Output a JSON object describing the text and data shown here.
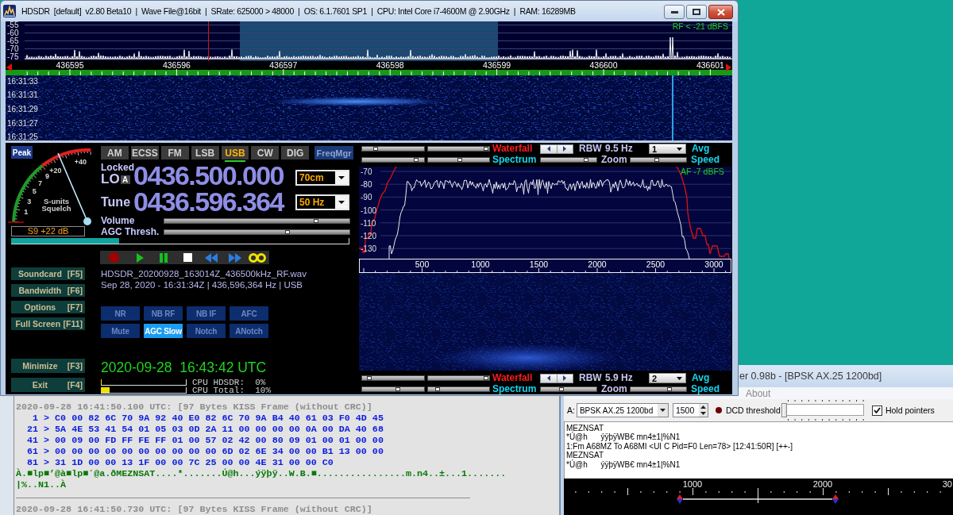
{
  "hdsdr": {
    "title": "HDSDR  [default]  v2.80 Beta10  |  Wave File@16bit  |  SRate: 625000 > 48000  |  OS: 6.1.7601 SP1  |  CPU: Intel Core i7-4600M @ 2.90GHz  |  RAM: 16289MB",
    "rf_spectrum": {
      "y_labels": [
        "-55",
        "-60",
        "-65",
        "-70",
        "-75"
      ],
      "reading": "RF < -21 dBFS",
      "freq_labels": [
        "436595",
        "436596",
        "436597",
        "436598",
        "436599",
        "436600",
        "436601"
      ]
    },
    "waterfall": {
      "times": [
        "16:31:33",
        "16:31:31",
        "16:31:29",
        "16:31:27",
        "16:31:25"
      ]
    },
    "s_meter": {
      "peak": "Peak",
      "scale": [
        "+40",
        "+20",
        "9",
        "7",
        "5",
        "3",
        "1"
      ],
      "captions": [
        "S-units",
        "Squelch"
      ],
      "reading": "S9 +22 dB",
      "level": 0.32
    },
    "modes": [
      {
        "label": "AM",
        "selected": false
      },
      {
        "label": "ECSS",
        "selected": false
      },
      {
        "label": "FM",
        "selected": false
      },
      {
        "label": "LSB",
        "selected": false
      },
      {
        "label": "USB",
        "selected": true
      },
      {
        "label": "CW",
        "selected": false
      },
      {
        "label": "DIG",
        "selected": false
      }
    ],
    "freq_manager": "FreqMgr",
    "lo": {
      "status": "Locked",
      "label": "LO",
      "vfo": "A",
      "frequency": "0436.500.000",
      "band": "70cm"
    },
    "tune": {
      "label": "Tune",
      "frequency": "0436.596.364",
      "step": "50 Hz"
    },
    "sliders": [
      {
        "label": "Volume",
        "level": 0.83
      },
      {
        "label": "AGC Thresh.",
        "level": 0.67
      }
    ],
    "recording": {
      "file": "HDSDR_20200928_163014Z_436500kHz_RF.wav",
      "info": "Sep 28, 2020 - 16:31:34Z | 436,596,364 Hz | USB"
    },
    "functions": [
      {
        "label": "NR",
        "on": false
      },
      {
        "label": "NB RF",
        "on": false
      },
      {
        "label": "NB IF",
        "on": false
      },
      {
        "label": "AFC",
        "on": false
      },
      {
        "label": "Mute",
        "on": false
      },
      {
        "label": "AGC Slow",
        "on": true
      },
      {
        "label": "Notch",
        "on": false
      },
      {
        "label": "ANotch",
        "on": false
      }
    ],
    "side_buttons": [
      {
        "label": "Soundcard",
        "key": "[F5]"
      },
      {
        "label": "Bandwidth",
        "key": "[F6]"
      },
      {
        "label": "Options",
        "key": "[F7]"
      },
      {
        "label": "Full Screen",
        "key": "[F11]"
      }
    ],
    "app_buttons": [
      {
        "label": "Minimize",
        "key": "[F3]"
      },
      {
        "label": "Exit",
        "key": "[F4]"
      }
    ],
    "clock": "2020-09-28  16:43:42 UTC",
    "cpu": [
      {
        "label": "CPU HDSDR:  0%",
        "level": 0
      },
      {
        "label": "CPU Total:  10%",
        "level": 0.1
      }
    ],
    "af_controls": [
      {
        "waterfall_label": "Waterfall",
        "rbw_label": "RBW",
        "rbw": "9.5 Hz",
        "avg": "1",
        "avg_label": "Avg",
        "spectrum_label": "Spectrum",
        "zoom_label": "Zoom",
        "speed_label": "Speed",
        "sliders": [
          {
            "level": 0.2
          },
          {
            "level": 0.98
          },
          {
            "level": 0.9
          },
          {
            "level": 0.52
          },
          {
            "level": 0.85
          },
          {
            "level": 0.47
          }
        ]
      },
      {
        "waterfall_label": "Waterfall",
        "rbw_label": "RBW",
        "rbw": "5.9 Hz",
        "avg": "2",
        "avg_label": "Avg",
        "spectrum_label": "Spectrum",
        "zoom_label": "Zoom",
        "speed_label": "Speed",
        "sliders": [
          {
            "level": 0.08
          },
          {
            "level": 0.99
          },
          {
            "level": 0.59
          },
          {
            "level": 0.13
          },
          {
            "level": 0.36
          },
          {
            "level": 0.72
          }
        ]
      }
    ],
    "af_spectrum": {
      "y_labels": [
        "-70",
        "-80",
        "-90",
        "-100",
        "-110",
        "-120",
        "-130"
      ],
      "reading": "AF  -7 dBFS",
      "freq_labels": [
        "500",
        "1000",
        "1500",
        "2000",
        "2500",
        "3000"
      ]
    }
  },
  "kiss_log": {
    "frames": [
      {
        "header": "2020-09-28 16:41:50.100 UTC: [97 Bytes KISS Frame (without CRC)]",
        "rows": [
          "   1 > C0 00 82 6C 70 9A 92 40 E0 82 6C 70 9A B4 40 61 03 F0 4D 45",
          "  21 > 5A 4E 53 41 54 01 05 03 0D 2A 11 00 00 00 00 0A 00 DA 40 68",
          "  41 > 00 09 00 FD FF FE FF 01 00 57 02 42 00 80 09 01 00 01 00 00",
          "  61 > 00 00 00 00 00 00 00 00 00 00 6D 02 6E 34 00 00 B1 13 00 00",
          "  81 > 31 1D 00 00 13 1F 00 00 7C 25 00 00 4E 31 00 00 C0"
        ],
        "ascii": [
          "À.■lp■’@à■lp■´@a.ðMEZNSAT....*.......Ú@h...ýÿþÿ..W.B.■................m.n4..±...1.......",
          "|%..N1..À"
        ]
      },
      {
        "header": "2020-09-28 16:41:50.730 UTC: [97 Bytes KISS Frame (without CRC)]"
      }
    ]
  },
  "modem": {
    "title": "er 0.98b - [BPSK AX.25 1200bd]",
    "menu": [
      "About"
    ],
    "channel": "A:",
    "mode": "BPSK AX.25 1200bd",
    "center": "1500",
    "dcd": {
      "on": false,
      "label": "DCD threshold",
      "level": 0
    },
    "hold_pointers": {
      "label": "Hold pointers",
      "checked": true
    },
    "log": [
      "MEZNSAT",
      "*Ú@h      ýÿþÿWB€ mn4±1|%N1",
      "1:Fm A68MZ To A68MI <UI C Pid=F0 Len=78> [12:41:50R] [++-]",
      "MEZNSAT",
      "*Ú@h      ýÿþÿWB€ mn4±1|%N1"
    ],
    "scale": [
      "1000",
      "2000",
      "30"
    ]
  }
}
